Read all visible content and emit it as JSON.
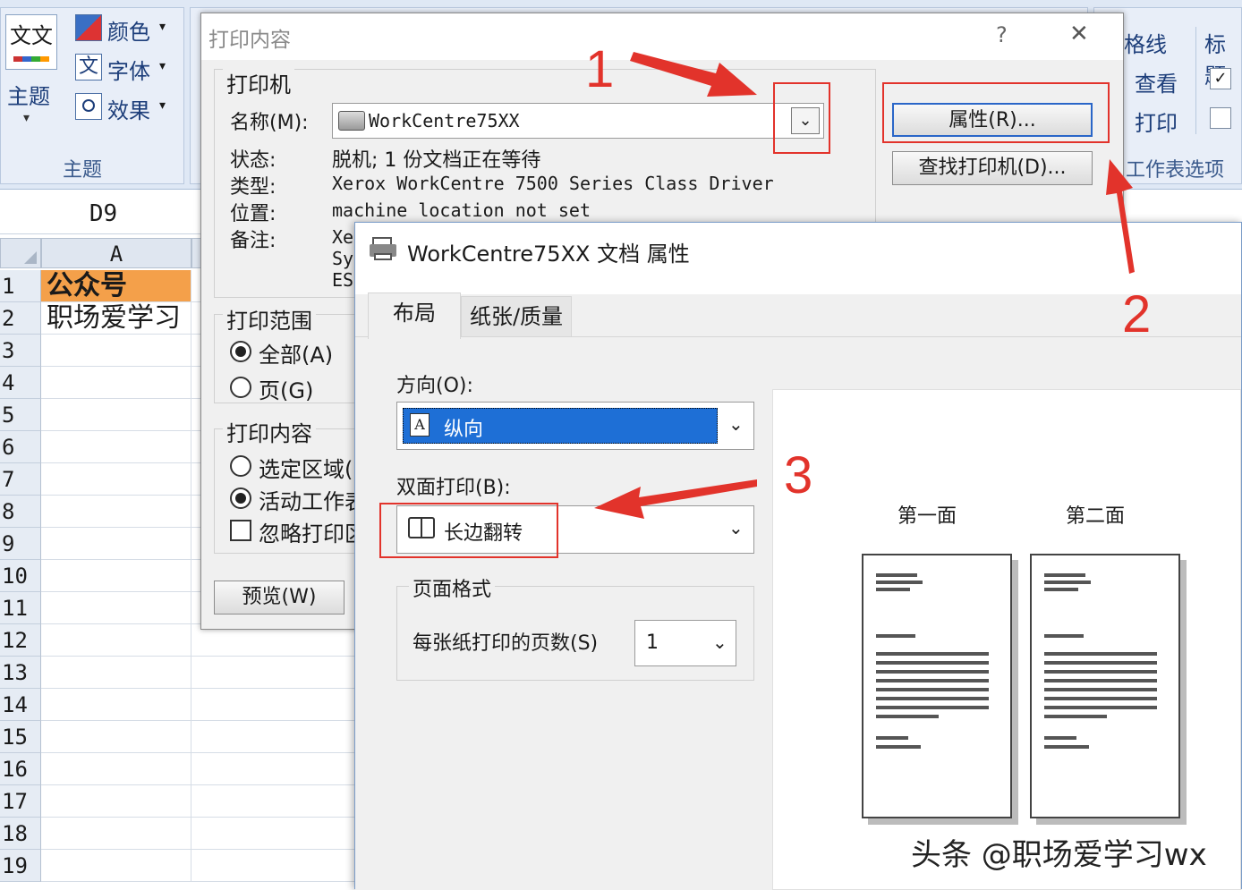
{
  "ribbon": {
    "theme_label": "主题",
    "theme_icon_text": "文文",
    "colors_label": "颜色",
    "fonts_label": "字体",
    "effects_label": "效果",
    "fonts_icon": "文",
    "group_title": "主题",
    "gridlines_label": "格线",
    "headings_label": "标题",
    "view_label": "查看",
    "print_label": "打印",
    "sheet_options_label": "工作表选项",
    "view_gridlines_checked": true,
    "print_gridlines_checked": false
  },
  "namebox": {
    "value": "D9"
  },
  "sheet": {
    "column_a": "A",
    "rows": [
      "1",
      "2",
      "3",
      "4",
      "5",
      "6",
      "7",
      "8",
      "9",
      "10",
      "11",
      "12",
      "13",
      "14",
      "15",
      "16",
      "17",
      "18",
      "19"
    ],
    "cells": {
      "a1": "公众号",
      "a2": "职场爱学习"
    },
    "highlight_color": "#f4a04a"
  },
  "print_dialog": {
    "title": "打印内容",
    "help_glyph": "?",
    "close_glyph": "✕",
    "printer_section": "打印机",
    "name_label": "名称(M):",
    "printer_name": "WorkCentre75XX",
    "status_label": "状态:",
    "status_value": "脱机; 1 份文档正在等待",
    "type_label": "类型:",
    "type_value": "Xerox WorkCentre 7500 Series Class Driver",
    "where_label": "位置:",
    "where_value": "machine location not set",
    "comment_label": "备注:",
    "comment_value_1": "Xe",
    "comment_value_2": "Sy",
    "comment_value_3": "ES",
    "properties_button": "属性(R)...",
    "find_printer_button": "查找打印机(D)...",
    "range_section": "打印范围",
    "range_all": "全部(A)",
    "range_pages": "页(G)",
    "content_section": "打印内容",
    "content_selection": "选定区域(",
    "content_active": "活动工作表",
    "content_ignore": "忽略打印区",
    "preview_button": "预览(W)"
  },
  "props_dialog": {
    "title": "WorkCentre75XX 文档 属性",
    "tab_layout": "布局",
    "tab_paper": "纸张/质量",
    "orientation_label": "方向(O):",
    "orientation_value": "纵向",
    "duplex_label": "双面打印(B):",
    "duplex_value": "长边翻转",
    "page_format_label": "页面格式",
    "pages_per_sheet_label": "每张纸打印的页数(S)",
    "pages_per_sheet_value": "1",
    "side1_label": "第一面",
    "side2_label": "第二面"
  },
  "annotations": {
    "num1": "1",
    "num2": "2",
    "num3": "3",
    "color": "#e2332b"
  },
  "watermark": "头条 @职场爱学习wx"
}
